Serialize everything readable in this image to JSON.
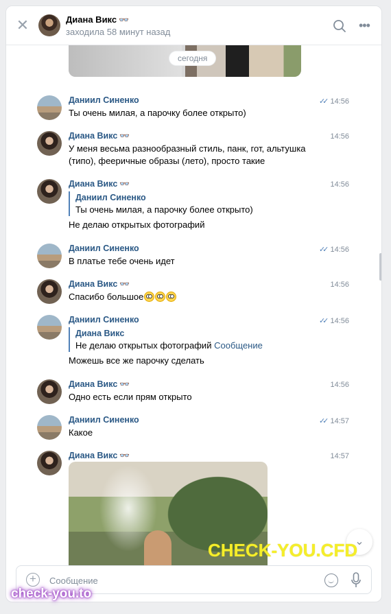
{
  "header": {
    "name": "Диана Викс",
    "name_icon": "glasses-icon",
    "status": "заходила 58 минут назад"
  },
  "date_separator": "сегодня",
  "messages": [
    {
      "sender": "Даниил Синенко",
      "time": "14:56",
      "read": true,
      "text": "Ты очень милая, а парочку более открыто)"
    },
    {
      "sender": "Диана Викс",
      "time": "14:56",
      "text": "У меня весьма разнообразный стиль, панк, гот, альтушка (типо), фееричные образы (лето), просто такие"
    },
    {
      "sender": "Диана Викс",
      "time": "14:56",
      "quote": {
        "name": "Даниил Синенко",
        "text": "Ты очень милая, а парочку более открыто)"
      },
      "text": "Не делаю открытых фотографий"
    },
    {
      "sender": "Даниил Синенко",
      "time": "14:56",
      "read": true,
      "text": "В платье тебе очень идет"
    },
    {
      "sender": "Диана Викс",
      "time": "14:56",
      "text": "Спасибо большое"
    },
    {
      "sender": "Даниил Синенко",
      "time": "14:56",
      "read": true,
      "quote": {
        "name": "Диана Викс",
        "text": "Не делаю открытых фотографий",
        "link": "Сообщение"
      },
      "text": "Можешь все же парочку сделать"
    },
    {
      "sender": "Диана Викс",
      "time": "14:56",
      "text": "Одно есть если прям открыто"
    },
    {
      "sender": "Даниил Синенко",
      "time": "14:57",
      "read": true,
      "text": "Какое"
    },
    {
      "sender": "Диана Викс",
      "time": "14:57"
    }
  ],
  "composer": {
    "placeholder": "Сообщение"
  },
  "watermarks": {
    "big": "CHECK-YOU.CFD",
    "small": "check-you.to"
  }
}
